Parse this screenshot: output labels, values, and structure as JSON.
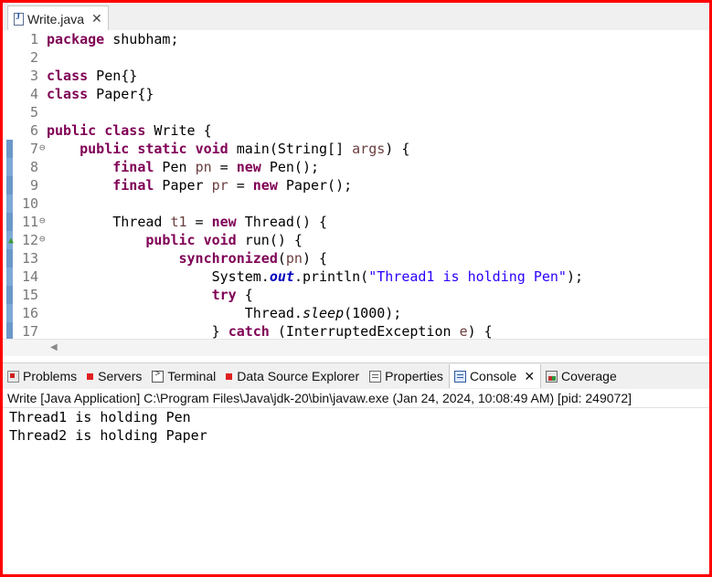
{
  "editor": {
    "tab": {
      "filename": "Write.java"
    },
    "lines": [
      {
        "n": "1",
        "tokens": [
          {
            "t": "package",
            "k": "kw"
          },
          {
            "t": " shubham;",
            "k": ""
          }
        ]
      },
      {
        "n": "2",
        "tokens": []
      },
      {
        "n": "3",
        "tokens": [
          {
            "t": "class",
            "k": "kw"
          },
          {
            "t": " Pen{}",
            "k": ""
          }
        ]
      },
      {
        "n": "4",
        "tokens": [
          {
            "t": "class",
            "k": "kw"
          },
          {
            "t": " Paper{}",
            "k": ""
          }
        ]
      },
      {
        "n": "5",
        "tokens": []
      },
      {
        "n": "6",
        "tokens": [
          {
            "t": "public",
            "k": "kw"
          },
          {
            "t": " ",
            "k": ""
          },
          {
            "t": "class",
            "k": "kw"
          },
          {
            "t": " Write {",
            "k": ""
          }
        ]
      },
      {
        "n": "7",
        "fold": "⊖",
        "tokens": [
          {
            "t": "    ",
            "k": ""
          },
          {
            "t": "public",
            "k": "kw"
          },
          {
            "t": " ",
            "k": ""
          },
          {
            "t": "static",
            "k": "kw"
          },
          {
            "t": " ",
            "k": ""
          },
          {
            "t": "void",
            "k": "kw"
          },
          {
            "t": " main(String[] ",
            "k": ""
          },
          {
            "t": "args",
            "k": "var"
          },
          {
            "t": ") {",
            "k": ""
          }
        ]
      },
      {
        "n": "8",
        "tokens": [
          {
            "t": "        ",
            "k": ""
          },
          {
            "t": "final",
            "k": "kw"
          },
          {
            "t": " Pen ",
            "k": ""
          },
          {
            "t": "pn",
            "k": "var"
          },
          {
            "t": " = ",
            "k": ""
          },
          {
            "t": "new",
            "k": "kw"
          },
          {
            "t": " Pen();",
            "k": ""
          }
        ]
      },
      {
        "n": "9",
        "tokens": [
          {
            "t": "        ",
            "k": ""
          },
          {
            "t": "final",
            "k": "kw"
          },
          {
            "t": " Paper ",
            "k": ""
          },
          {
            "t": "pr",
            "k": "var"
          },
          {
            "t": " = ",
            "k": ""
          },
          {
            "t": "new",
            "k": "kw"
          },
          {
            "t": " Paper();",
            "k": ""
          }
        ]
      },
      {
        "n": "10",
        "tokens": []
      },
      {
        "n": "11",
        "fold": "⊖",
        "tokens": [
          {
            "t": "        Thread ",
            "k": ""
          },
          {
            "t": "t1",
            "k": "var"
          },
          {
            "t": " = ",
            "k": ""
          },
          {
            "t": "new",
            "k": "kw"
          },
          {
            "t": " Thread() {",
            "k": ""
          }
        ]
      },
      {
        "n": "12",
        "fold": "⊖",
        "override": "▲",
        "tokens": [
          {
            "t": "            ",
            "k": ""
          },
          {
            "t": "public",
            "k": "kw"
          },
          {
            "t": " ",
            "k": ""
          },
          {
            "t": "void",
            "k": "kw"
          },
          {
            "t": " run() {",
            "k": ""
          }
        ]
      },
      {
        "n": "13",
        "tokens": [
          {
            "t": "                ",
            "k": ""
          },
          {
            "t": "synchronized",
            "k": "kw"
          },
          {
            "t": "(",
            "k": ""
          },
          {
            "t": "pn",
            "k": "var"
          },
          {
            "t": ") {",
            "k": ""
          }
        ]
      },
      {
        "n": "14",
        "tokens": [
          {
            "t": "                    System.",
            "k": ""
          },
          {
            "t": "out",
            "k": "fld"
          },
          {
            "t": ".println(",
            "k": ""
          },
          {
            "t": "\"Thread1 is holding Pen\"",
            "k": "str"
          },
          {
            "t": ");",
            "k": ""
          }
        ]
      },
      {
        "n": "15",
        "tokens": [
          {
            "t": "                    ",
            "k": ""
          },
          {
            "t": "try",
            "k": "kw"
          },
          {
            "t": " {",
            "k": ""
          }
        ]
      },
      {
        "n": "16",
        "tokens": [
          {
            "t": "                        Thread.",
            "k": ""
          },
          {
            "t": "sleep",
            "k": "smeth"
          },
          {
            "t": "(1000);",
            "k": ""
          }
        ]
      },
      {
        "n": "17",
        "tokens": [
          {
            "t": "                    } ",
            "k": ""
          },
          {
            "t": "catch",
            "k": "kw"
          },
          {
            "t": " (InterruptedException ",
            "k": ""
          },
          {
            "t": "e",
            "k": "var"
          },
          {
            "t": ") {",
            "k": ""
          }
        ]
      }
    ]
  },
  "views": {
    "tabs": [
      {
        "label": "Problems",
        "icon": "problems-icon"
      },
      {
        "label": "Servers",
        "icon": "servers-icon"
      },
      {
        "label": "Terminal",
        "icon": "terminal-icon"
      },
      {
        "label": "Data Source Explorer",
        "icon": "data-source-icon"
      },
      {
        "label": "Properties",
        "icon": "properties-icon"
      },
      {
        "label": "Console",
        "icon": "console-icon",
        "active": true
      },
      {
        "label": "Coverage",
        "icon": "coverage-icon"
      }
    ]
  },
  "console": {
    "header": "Write [Java Application] C:\\Program Files\\Java\\jdk-20\\bin\\javaw.exe  (Jan 24, 2024, 10:08:49 AM) [pid: 249072]",
    "output": [
      "Thread1 is holding Pen",
      "Thread2 is holding Paper"
    ]
  },
  "colors": {
    "frame_border": "#ff0000",
    "keyword": "#7f0055",
    "string": "#2a00ff",
    "field": "#0000c0",
    "variable": "#6a3e3e"
  }
}
